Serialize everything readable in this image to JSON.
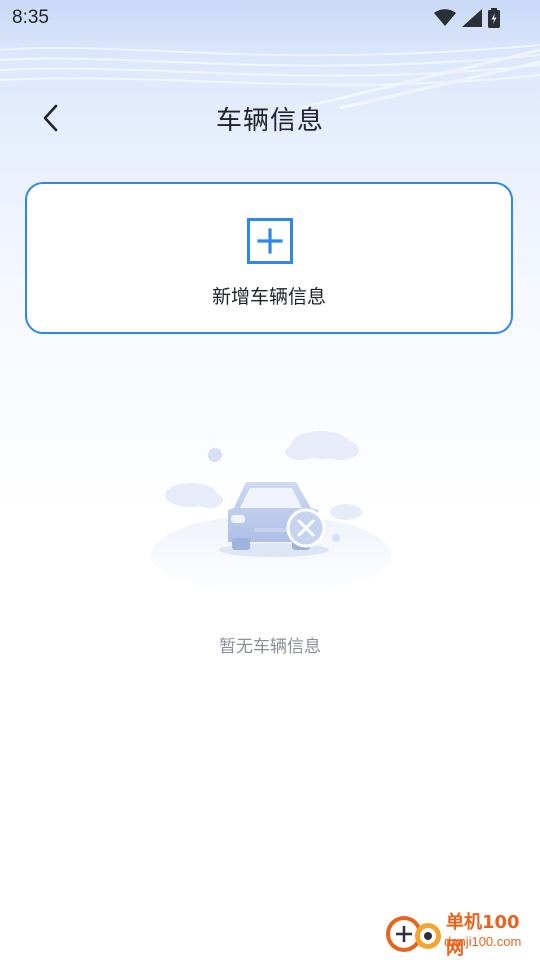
{
  "status_bar": {
    "time": "8:35",
    "icons": [
      "wifi-icon",
      "signal-icon",
      "battery-icon"
    ]
  },
  "header": {
    "back_icon": "chevron-left-icon",
    "title": "车辆信息"
  },
  "add_card": {
    "icon": "plus-square-icon",
    "label": "新增车辆信息"
  },
  "empty_state": {
    "illustration": "car-with-x-illustration",
    "message": "暂无车辆信息"
  },
  "watermark": {
    "brand": "单机100网",
    "url": "danji100.com"
  },
  "colors": {
    "accent": "#2f86ec",
    "text_primary": "#1f2329",
    "text_secondary": "#8a8f99",
    "watermark": "#e8641e"
  }
}
